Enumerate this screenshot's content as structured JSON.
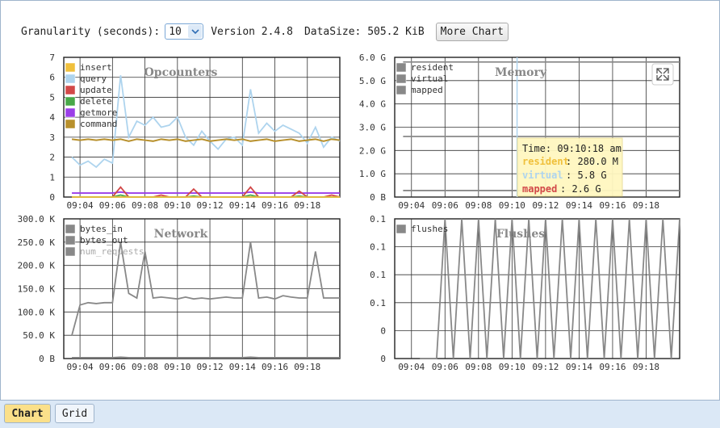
{
  "toolbar": {
    "granularity_label": "Granularity (seconds):",
    "granularity_value": "10",
    "version": "Version 2.4.8",
    "datasize": "DataSize: 505.2 KiB",
    "more_chart_label": "More Chart"
  },
  "tabs": [
    {
      "label": "Chart",
      "active": true
    },
    {
      "label": "Grid",
      "active": false
    }
  ],
  "colors": {
    "insert": "#f0c03c",
    "query": "#aed4ee",
    "update": "#d24848",
    "delete": "#48a848",
    "getmore": "#9b3ee8",
    "command": "#b8902c",
    "tooltip_bg": "#fff7c0"
  },
  "charts": {
    "opcounters": {
      "title": "Opcounters",
      "yticks": [
        "7",
        "6",
        "5",
        "4",
        "3",
        "2",
        "1",
        "0"
      ],
      "xticks": [
        "09:04",
        "09:06",
        "09:08",
        "09:10",
        "09:12",
        "09:14",
        "09:16",
        "09:18"
      ],
      "legend": [
        "insert",
        "query",
        "update",
        "delete",
        "getmore",
        "command"
      ]
    },
    "memory": {
      "title": "Memory",
      "yticks": [
        "6.0 G",
        "5.0 G",
        "4.0 G",
        "3.0 G",
        "2.0 G",
        "1.0 G",
        "0 B"
      ],
      "xticks": [
        "09:04",
        "09:06",
        "09:08",
        "09:10",
        "09:12",
        "09:14",
        "09:16",
        "09:18"
      ],
      "legend": [
        "resident",
        "virtual",
        "mapped"
      ],
      "tooltip": {
        "time": "Time: 09:10:18 am",
        "rows": [
          {
            "name": "resident",
            "value": "280.0 M"
          },
          {
            "name": "virtual",
            "value": "5.8 G"
          },
          {
            "name": "mapped",
            "value": "2.6 G"
          }
        ]
      }
    },
    "network": {
      "title": "Network",
      "yticks": [
        "300.0 K",
        "250.0 K",
        "200.0 K",
        "150.0 K",
        "100.0 K",
        "50.0 K",
        "0 B"
      ],
      "xticks": [
        "09:04",
        "09:06",
        "09:08",
        "09:10",
        "09:12",
        "09:14",
        "09:16",
        "09:18"
      ],
      "legend": [
        "bytes_in",
        "bytes_out",
        "num_requests"
      ]
    },
    "flushes": {
      "title": "Flushes",
      "yticks": [
        "0.1",
        "0.1",
        "0.1",
        "0.1",
        "0",
        "0"
      ],
      "xticks": [
        "09:04",
        "09:06",
        "09:08",
        "09:10",
        "09:12",
        "09:14",
        "09:16",
        "09:18"
      ],
      "legend": [
        "flushes"
      ]
    }
  },
  "chart_data": [
    {
      "type": "line",
      "title": "Opcounters",
      "ylim": [
        0,
        7
      ],
      "x": [
        "09:03:30",
        "09:04:00",
        "09:04:30",
        "09:05:00",
        "09:05:30",
        "09:06:00",
        "09:06:30",
        "09:07:00",
        "09:07:30",
        "09:08:00",
        "09:08:30",
        "09:09:00",
        "09:09:30",
        "09:10:00",
        "09:10:30",
        "09:11:00",
        "09:11:30",
        "09:12:00",
        "09:12:30",
        "09:13:00",
        "09:13:30",
        "09:14:00",
        "09:14:30",
        "09:15:00",
        "09:15:30",
        "09:16:00",
        "09:16:30",
        "09:17:00",
        "09:17:30",
        "09:18:00",
        "09:18:30",
        "09:19:00",
        "09:19:30",
        "09:20:00"
      ],
      "series": [
        {
          "name": "query",
          "values": [
            2,
            1.6,
            1.8,
            1.5,
            1.9,
            1.7,
            6.1,
            3,
            3.8,
            3.6,
            4,
            3.5,
            3.6,
            4,
            3,
            2.6,
            3.3,
            2.8,
            2.4,
            2.9,
            3,
            2.6,
            5.4,
            3.2,
            3.7,
            3.3,
            3.6,
            3.4,
            3.2,
            2.7,
            3.5,
            2.5,
            3,
            2.8
          ]
        },
        {
          "name": "command",
          "values": [
            2.9,
            2.85,
            2.9,
            2.85,
            2.9,
            2.85,
            2.9,
            2.8,
            2.9,
            2.85,
            2.8,
            2.9,
            2.85,
            2.9,
            2.8,
            2.85,
            2.9,
            2.8,
            2.85,
            2.9,
            2.85,
            2.9,
            2.8,
            2.85,
            2.9,
            2.8,
            2.85,
            2.9,
            2.8,
            2.85,
            2.9,
            2.8,
            2.9,
            2.85
          ]
        },
        {
          "name": "getmore",
          "values": [
            0.2,
            0.2,
            0.2,
            0.2,
            0.2,
            0.2,
            0.25,
            0.2,
            0.2,
            0.2,
            0.2,
            0.2,
            0.2,
            0.2,
            0.2,
            0.2,
            0.2,
            0.2,
            0.2,
            0.2,
            0.2,
            0.2,
            0.25,
            0.2,
            0.2,
            0.2,
            0.2,
            0.2,
            0.2,
            0.2,
            0.2,
            0.2,
            0.2,
            0.2
          ]
        },
        {
          "name": "update",
          "values": [
            0,
            0,
            0,
            0,
            0,
            0,
            0.5,
            0,
            0,
            0,
            0,
            0.1,
            0,
            0,
            0,
            0.4,
            0,
            0,
            0,
            0,
            0,
            0,
            0.5,
            0,
            0,
            0,
            0,
            0,
            0.3,
            0,
            0,
            0,
            0.1,
            0
          ]
        },
        {
          "name": "delete",
          "values": [
            0,
            0,
            0,
            0,
            0,
            0,
            0.1,
            0,
            0,
            0,
            0,
            0,
            0,
            0,
            0,
            0.05,
            0,
            0,
            0,
            0,
            0,
            0,
            0.1,
            0,
            0,
            0,
            0,
            0,
            0.05,
            0,
            0,
            0,
            0,
            0
          ]
        },
        {
          "name": "insert",
          "values": [
            0,
            0,
            0,
            0,
            0,
            0,
            0,
            0,
            0,
            0,
            0,
            0,
            0,
            0,
            0,
            0,
            0,
            0,
            0,
            0,
            0,
            0,
            0,
            0,
            0,
            0,
            0,
            0,
            0,
            0,
            0,
            0,
            0,
            0
          ]
        }
      ]
    },
    {
      "type": "line",
      "title": "Memory",
      "ylim": [
        0,
        6
      ],
      "x": [
        "09:03:30",
        "09:20:00"
      ],
      "series": [
        {
          "name": "virtual",
          "values": [
            5.8,
            5.8
          ]
        },
        {
          "name": "mapped",
          "values": [
            2.6,
            2.6
          ]
        },
        {
          "name": "resident",
          "values": [
            0.28,
            0.28
          ]
        }
      ]
    },
    {
      "type": "line",
      "title": "Network",
      "ylim": [
        0,
        300
      ],
      "x": [
        "09:03:30",
        "09:04:00",
        "09:04:30",
        "09:05:00",
        "09:05:30",
        "09:06:00",
        "09:06:30",
        "09:07:00",
        "09:07:30",
        "09:08:00",
        "09:08:30",
        "09:09:00",
        "09:09:30",
        "09:10:00",
        "09:10:30",
        "09:11:00",
        "09:11:30",
        "09:12:00",
        "09:12:30",
        "09:13:00",
        "09:13:30",
        "09:14:00",
        "09:14:30",
        "09:15:00",
        "09:15:30",
        "09:16:00",
        "09:16:30",
        "09:17:00",
        "09:17:30",
        "09:18:00",
        "09:18:30",
        "09:19:00",
        "09:19:30",
        "09:20:00"
      ],
      "series": [
        {
          "name": "bytes_out",
          "values": [
            50,
            115,
            120,
            118,
            120,
            120,
            250,
            140,
            130,
            230,
            130,
            132,
            130,
            128,
            132,
            128,
            130,
            128,
            130,
            132,
            130,
            130,
            250,
            130,
            132,
            128,
            135,
            132,
            130,
            130,
            230,
            130,
            130,
            130
          ]
        },
        {
          "name": "bytes_in",
          "values": [
            2,
            2,
            2,
            2,
            2,
            2,
            3,
            2,
            2,
            2,
            2,
            2,
            2,
            2,
            2,
            2,
            2,
            2,
            2,
            2,
            2,
            2,
            3,
            2,
            2,
            2,
            2,
            2,
            2,
            2,
            2,
            2,
            2,
            2
          ]
        },
        {
          "name": "num_requests",
          "values": []
        }
      ]
    },
    {
      "type": "line",
      "title": "Flushes",
      "ylim": [
        0,
        0.1
      ],
      "x": [
        "09:04:30",
        "09:05:00",
        "09:05:30",
        "09:06:00",
        "09:06:30",
        "09:07:00",
        "09:07:30",
        "09:08:00",
        "09:08:30",
        "09:09:00",
        "09:09:30",
        "09:10:00",
        "09:10:30",
        "09:11:00",
        "09:11:30",
        "09:12:00",
        "09:12:30",
        "09:13:00",
        "09:13:30",
        "09:14:00",
        "09:14:30",
        "09:15:00",
        "09:15:30",
        "09:16:00",
        "09:16:30",
        "09:17:00",
        "09:17:30",
        "09:18:00",
        "09:18:30",
        "09:19:00",
        "09:19:30",
        "09:20:00"
      ],
      "series": [
        {
          "name": "flushes",
          "values": [
            0,
            0,
            0,
            0.1,
            0,
            0.1,
            0,
            0.1,
            0,
            0.1,
            0,
            0.1,
            0,
            0.1,
            0,
            0.1,
            0,
            0.1,
            0,
            0.1,
            0,
            0.1,
            0,
            0.1,
            0,
            0.1,
            0,
            0.1,
            0,
            0.1,
            0,
            0.1
          ]
        }
      ]
    }
  ]
}
